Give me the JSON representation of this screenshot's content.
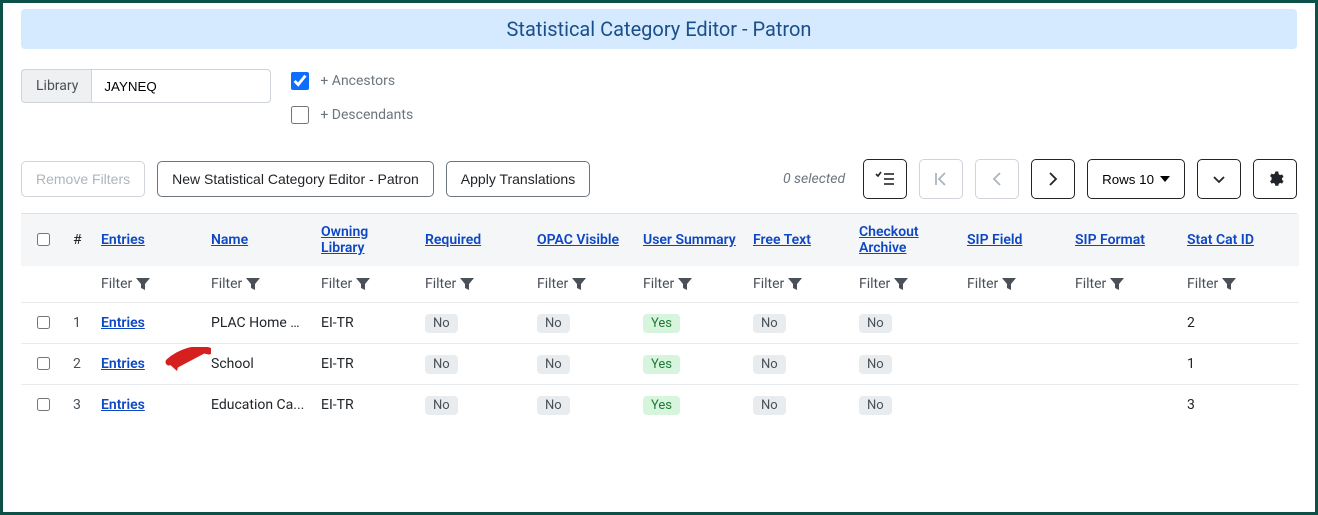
{
  "header": {
    "title": "Statistical Category Editor - Patron"
  },
  "library": {
    "label": "Library",
    "value": "JAYNEQ"
  },
  "ancestors": {
    "checked": true,
    "label": "+ Ancestors"
  },
  "descendants": {
    "checked": false,
    "label": "+ Descendants"
  },
  "toolbar": {
    "remove_filters": "Remove Filters",
    "new_item": "New Statistical Category Editor - Patron",
    "apply_translations": "Apply Translations",
    "selected_text": "0 selected",
    "rows_label": "Rows 10"
  },
  "columns": {
    "entries": "Entries",
    "name": "Name",
    "owning": "Owning Library",
    "required": "Required",
    "opac": "OPAC Visible",
    "user": "User Summary",
    "free": "Free Text",
    "checkout": "Checkout Archive",
    "sip_field": "SIP Field",
    "sip_format": "SIP Format",
    "stat_id": "Stat Cat ID",
    "num": "#",
    "filter": "Filter"
  },
  "rows": [
    {
      "num": "1",
      "entries": "Entries",
      "name": "PLAC Home L...",
      "owning": "EI-TR",
      "required": "No",
      "opac": "No",
      "user": "Yes",
      "free": "No",
      "checkout": "No",
      "sip_field": "",
      "sip_format": "",
      "id": "2"
    },
    {
      "num": "2",
      "entries": "Entries",
      "name": "School",
      "owning": "EI-TR",
      "required": "No",
      "opac": "No",
      "user": "Yes",
      "free": "No",
      "checkout": "No",
      "sip_field": "",
      "sip_format": "",
      "id": "1"
    },
    {
      "num": "3",
      "entries": "Entries",
      "name": "Education Ca...",
      "owning": "EI-TR",
      "required": "No",
      "opac": "No",
      "user": "Yes",
      "free": "No",
      "checkout": "No",
      "sip_field": "",
      "sip_format": "",
      "id": "3"
    }
  ]
}
